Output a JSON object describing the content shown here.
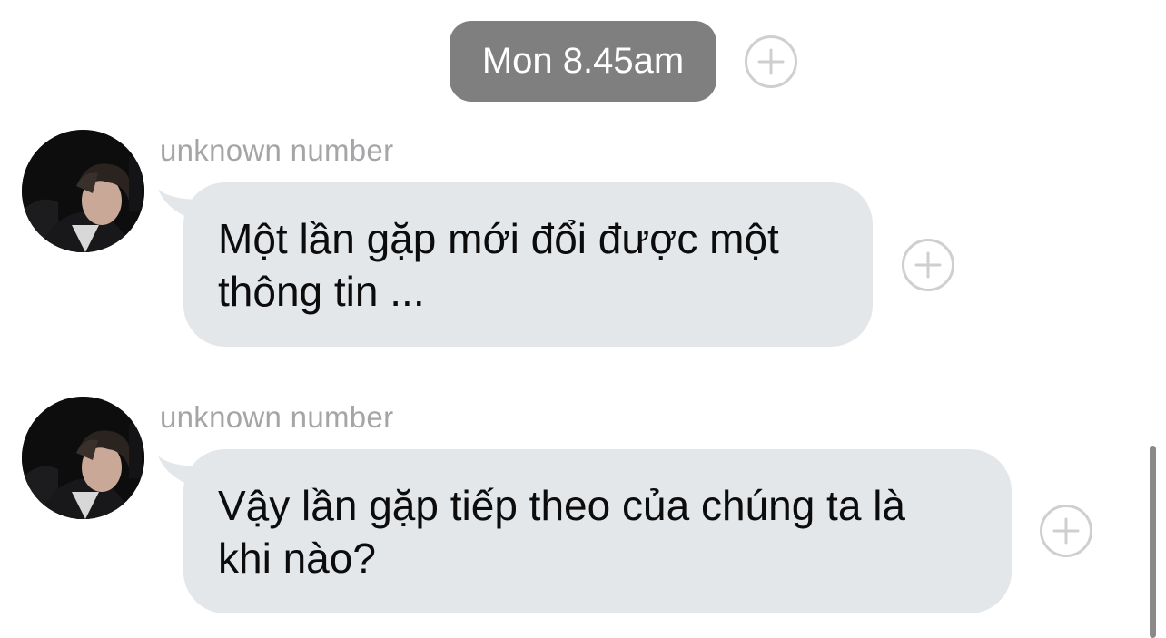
{
  "timestamp": "Mon 8.45am",
  "messages": [
    {
      "sender": "unknown number",
      "line1": "Một lần gặp mới đổi được một",
      "line2": "thông tin ..."
    },
    {
      "sender": "unknown number",
      "line1": "Vậy lần gặp tiếp theo của chúng ta là",
      "line2": "khi nào?"
    }
  ],
  "colors": {
    "timestamp_bg": "#7f7f7f",
    "bubble_bg": "#e4e7ea",
    "sender_text": "#a5a5a8",
    "plus_outline": "#cfcfd1"
  },
  "icons": {
    "reaction": "plus-circle-icon",
    "avatar": "user-photo-avatar"
  }
}
